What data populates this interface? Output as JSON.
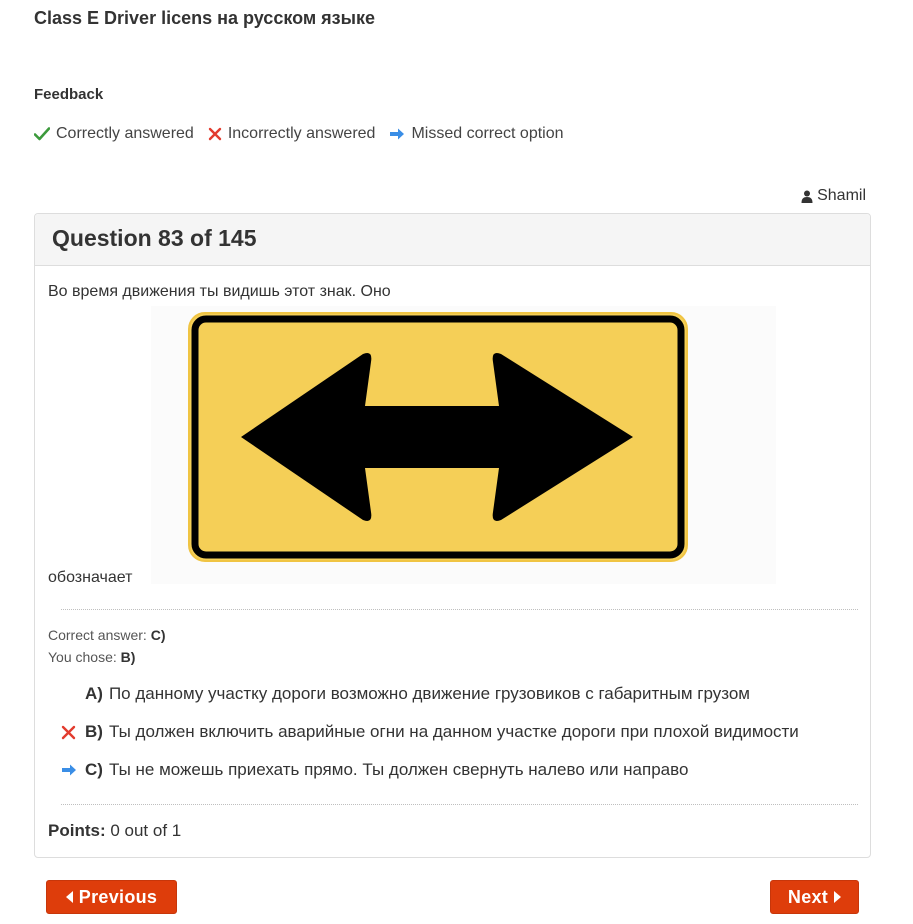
{
  "header": {
    "title": "Class E Driver licens на русском языке"
  },
  "feedback": {
    "heading": "Feedback",
    "legend": [
      {
        "icon": "check-icon",
        "label": "Correctly answered",
        "color": "#3c9a3c"
      },
      {
        "icon": "cross-icon",
        "label": "Incorrectly answered",
        "color": "#e23b2e"
      },
      {
        "icon": "arrow-right-icon",
        "label": "Missed correct option",
        "color": "#3a8ee6"
      }
    ]
  },
  "user": {
    "icon": "user-icon",
    "name": "Shamil"
  },
  "question": {
    "heading": "Question 83 of 145",
    "text_before": "Во время движения ты видишь этот знак. Оно",
    "text_after": "обозначает",
    "image": {
      "icon": "double-arrow-sign-icon",
      "sign_color": "#f5cf57",
      "border_color": "#000000"
    },
    "correct_answer_label": "Correct answer:",
    "correct_answer_value": "C)",
    "you_chose_label": "You chose:",
    "you_chose_value": "B)",
    "options": [
      {
        "letter": "A)",
        "text": "По данному участку дороги возможно движение грузовиков с габаритным грузом",
        "mark": ""
      },
      {
        "letter": "B)",
        "text": "Ты должен включить аварийные огни на данном участке дороги при плохой видимости",
        "mark": "cross-icon"
      },
      {
        "letter": "C)",
        "text": "Ты не можешь приехать прямо. Ты должен свернуть налево или направо",
        "mark": "arrow-right-icon"
      }
    ],
    "points_label": "Points:",
    "points_value": "0 out of 1"
  },
  "nav": {
    "prev_label": "Previous",
    "next_label": "Next",
    "button_color": "#de3d0b"
  }
}
